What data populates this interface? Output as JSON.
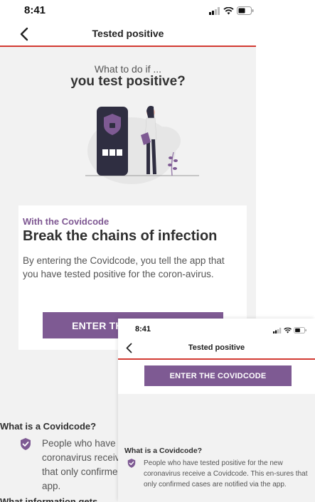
{
  "status_bar": {
    "time": "8:41"
  },
  "nav": {
    "title": "Tested positive"
  },
  "hero": {
    "pre_title": "What to do if ...",
    "title": "you test positive?"
  },
  "card": {
    "kicker": "With the Covidcode",
    "title": "Break the chains of infection",
    "body": "By entering the Covidcode, you tell the app that you have tested positive for the coron-avirus.",
    "button_label": "ENTER THE COVIDCODE"
  },
  "faq": {
    "heading": "What is a Covidcode?",
    "answer": "People who have tested positive for the new coronavirus receive a Covidcode. This en-sures that only confirmed cases are notified via the app.",
    "next_heading": "What information gets"
  },
  "colors": {
    "accent": "#7e5a93",
    "nav_border": "#d23a32",
    "background": "#f2f2f2"
  }
}
